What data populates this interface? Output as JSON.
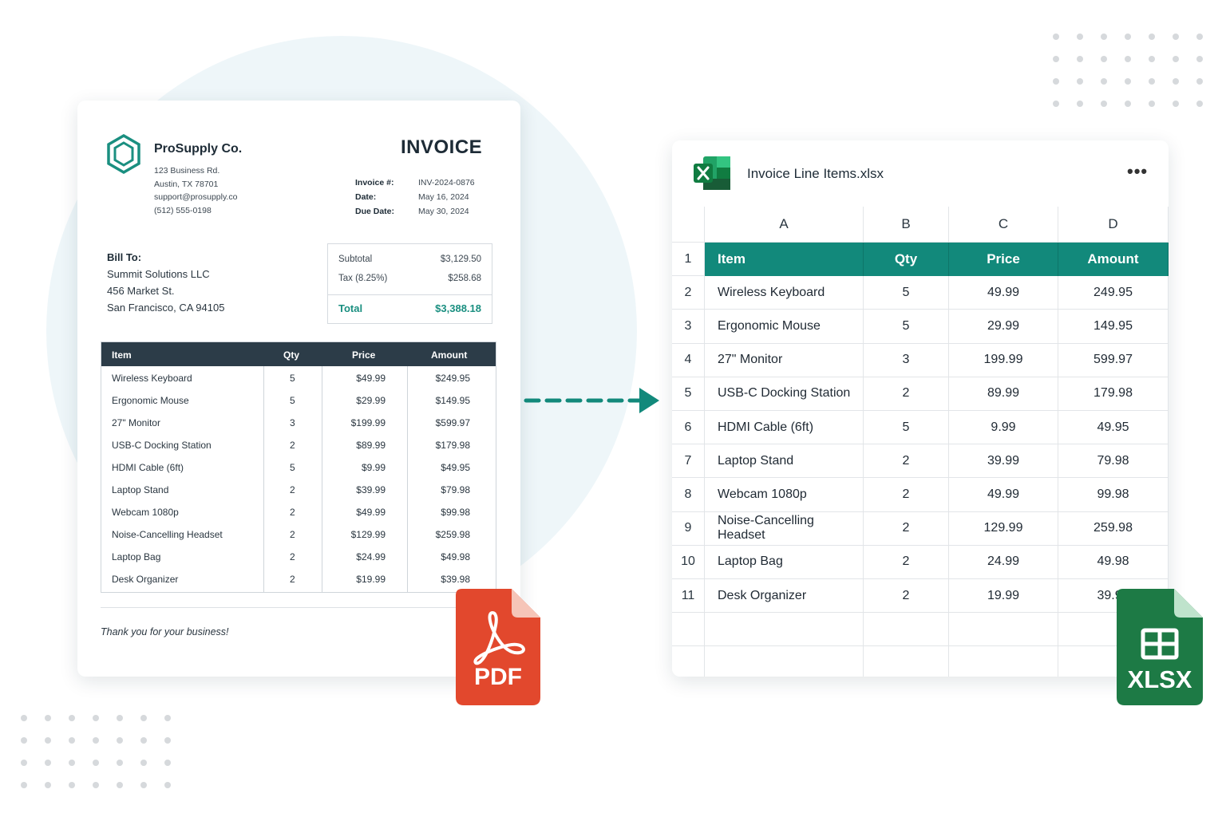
{
  "invoice": {
    "company": "ProSupply Co.",
    "address": [
      "123 Business Rd.",
      "Austin, TX 78701",
      "support@prosupply.co",
      "(512) 555-0198"
    ],
    "title": "INVOICE",
    "meta": [
      {
        "k": "Invoice #:",
        "v": "INV-2024-0876"
      },
      {
        "k": "Date:",
        "v": "May 16, 2024"
      },
      {
        "k": "Due Date:",
        "v": "May 30, 2024"
      }
    ],
    "bill_to": {
      "label": "Bill To:",
      "lines": [
        "Summit Solutions LLC",
        "456 Market St.",
        "San Francisco, CA 94105"
      ]
    },
    "totals": {
      "subtotal_label": "Subtotal",
      "subtotal": "$3,129.50",
      "tax_label": "Tax (8.25%)",
      "tax": "$258.68",
      "total_label": "Total",
      "total": "$3,388.18"
    },
    "columns": [
      "Item",
      "Qty",
      "Price",
      "Amount"
    ],
    "rows": [
      [
        "Wireless Keyboard",
        "5",
        "$49.99",
        "$249.95"
      ],
      [
        "Ergonomic Mouse",
        "5",
        "$29.99",
        "$149.95"
      ],
      [
        "27\" Monitor",
        "3",
        "$199.99",
        "$599.97"
      ],
      [
        "USB-C Docking Station",
        "2",
        "$89.99",
        "$179.98"
      ],
      [
        "HDMI Cable (6ft)",
        "5",
        "$9.99",
        "$49.95"
      ],
      [
        "Laptop Stand",
        "2",
        "$39.99",
        "$79.98"
      ],
      [
        "Webcam 1080p",
        "2",
        "$49.99",
        "$99.98"
      ],
      [
        "Noise-Cancelling Headset",
        "2",
        "$129.99",
        "$259.98"
      ],
      [
        "Laptop Bag",
        "2",
        "$24.99",
        "$49.98"
      ],
      [
        "Desk Organizer",
        "2",
        "$19.99",
        "$39.98"
      ]
    ],
    "thanks": "Thank you for your business!"
  },
  "badges": {
    "pdf": "PDF",
    "xlsx": "XLSX"
  },
  "sheet": {
    "title": "Invoice Line Items.xlsx",
    "more": "•••",
    "col_letters": [
      "A",
      "B",
      "C",
      "D"
    ],
    "headers": [
      "Item",
      "Qty",
      "Price",
      "Amount"
    ],
    "row_numbers": [
      "1",
      "2",
      "3",
      "4",
      "5",
      "6",
      "7",
      "8",
      "9",
      "10",
      "11"
    ],
    "rows": [
      [
        "Wireless Keyboard",
        "5",
        "49.99",
        "249.95"
      ],
      [
        "Ergonomic Mouse",
        "5",
        "29.99",
        "149.95"
      ],
      [
        "27\" Monitor",
        "3",
        "199.99",
        "599.97"
      ],
      [
        "USB-C Docking Station",
        "2",
        "89.99",
        "179.98"
      ],
      [
        "HDMI Cable (6ft)",
        "5",
        "9.99",
        "49.95"
      ],
      [
        "Laptop Stand",
        "2",
        "39.99",
        "79.98"
      ],
      [
        "Webcam 1080p",
        "2",
        "49.99",
        "99.98"
      ],
      [
        "Noise-Cancelling Headset",
        "2",
        "129.99",
        "259.98"
      ],
      [
        "Laptop Bag",
        "2",
        "24.99",
        "49.98"
      ],
      [
        "Desk Organizer",
        "2",
        "19.99",
        "39.98"
      ]
    ]
  },
  "colors": {
    "teal": "#12897b",
    "pdf_red": "#e2482d",
    "xlsx_green": "#1d7a45",
    "table_head": "#2c3c48"
  },
  "icons": [
    "hexagon-logo-icon",
    "acrobat-icon",
    "excel-icon",
    "grid-icon",
    "arrow-right-icon"
  ]
}
